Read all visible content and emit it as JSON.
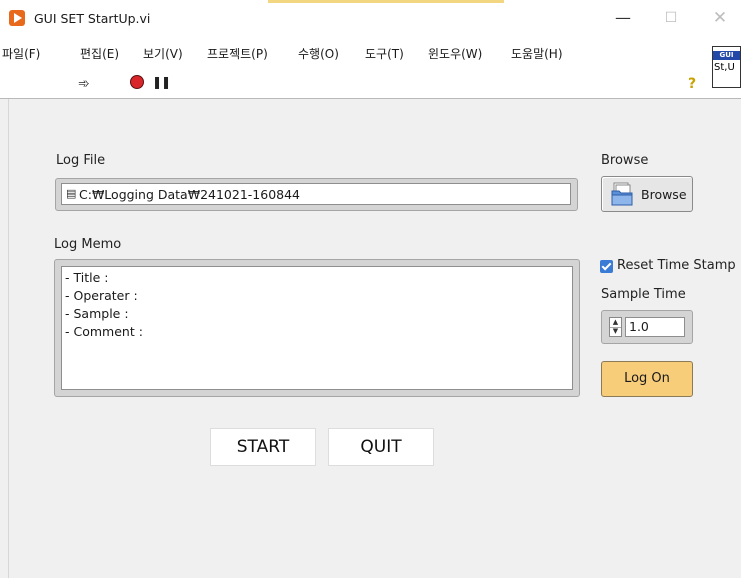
{
  "window": {
    "title": "GUI SET StartUp.vi",
    "minimize": "—",
    "maximize": "☐",
    "close": "✕",
    "app_icon": "labview-run-icon"
  },
  "menu": {
    "items": [
      "파일(F)",
      "편집(E)",
      "보기(V)",
      "프로젝트(P)",
      "수행(O)",
      "도구(T)",
      "윈도우(W)",
      "도움말(H)"
    ]
  },
  "toolbar": {
    "run_icon": "run-arrow-icon",
    "abort_icon": "abort-execution-icon",
    "pause_icon": "pause-icon",
    "help_icon": "context-help-icon",
    "vi_icon_band": "GUI",
    "vi_icon_text": "St,U"
  },
  "panel": {
    "log_file_label": "Log File",
    "log_file_path": "C:₩Logging Data₩241021-160844",
    "browse_label": "Browse",
    "browse_button": "Browse",
    "log_memo_label": "Log Memo",
    "log_memo_lines": [
      "- Title :",
      "- Operater :",
      "- Sample :",
      "- Comment :"
    ],
    "reset_time_stamp_label": "Reset Time Stamp",
    "reset_time_stamp_checked": true,
    "sample_time_label": "Sample Time",
    "sample_time_value": "1.0",
    "log_on_button": "Log On",
    "start_button": "START",
    "quit_button": "QUIT",
    "colors": {
      "panel_bg": "#f0f0f0",
      "log_on_bg": "#f7cd7a",
      "checkbox": "#3a7bd5",
      "app_icon": "#e8691c"
    }
  }
}
